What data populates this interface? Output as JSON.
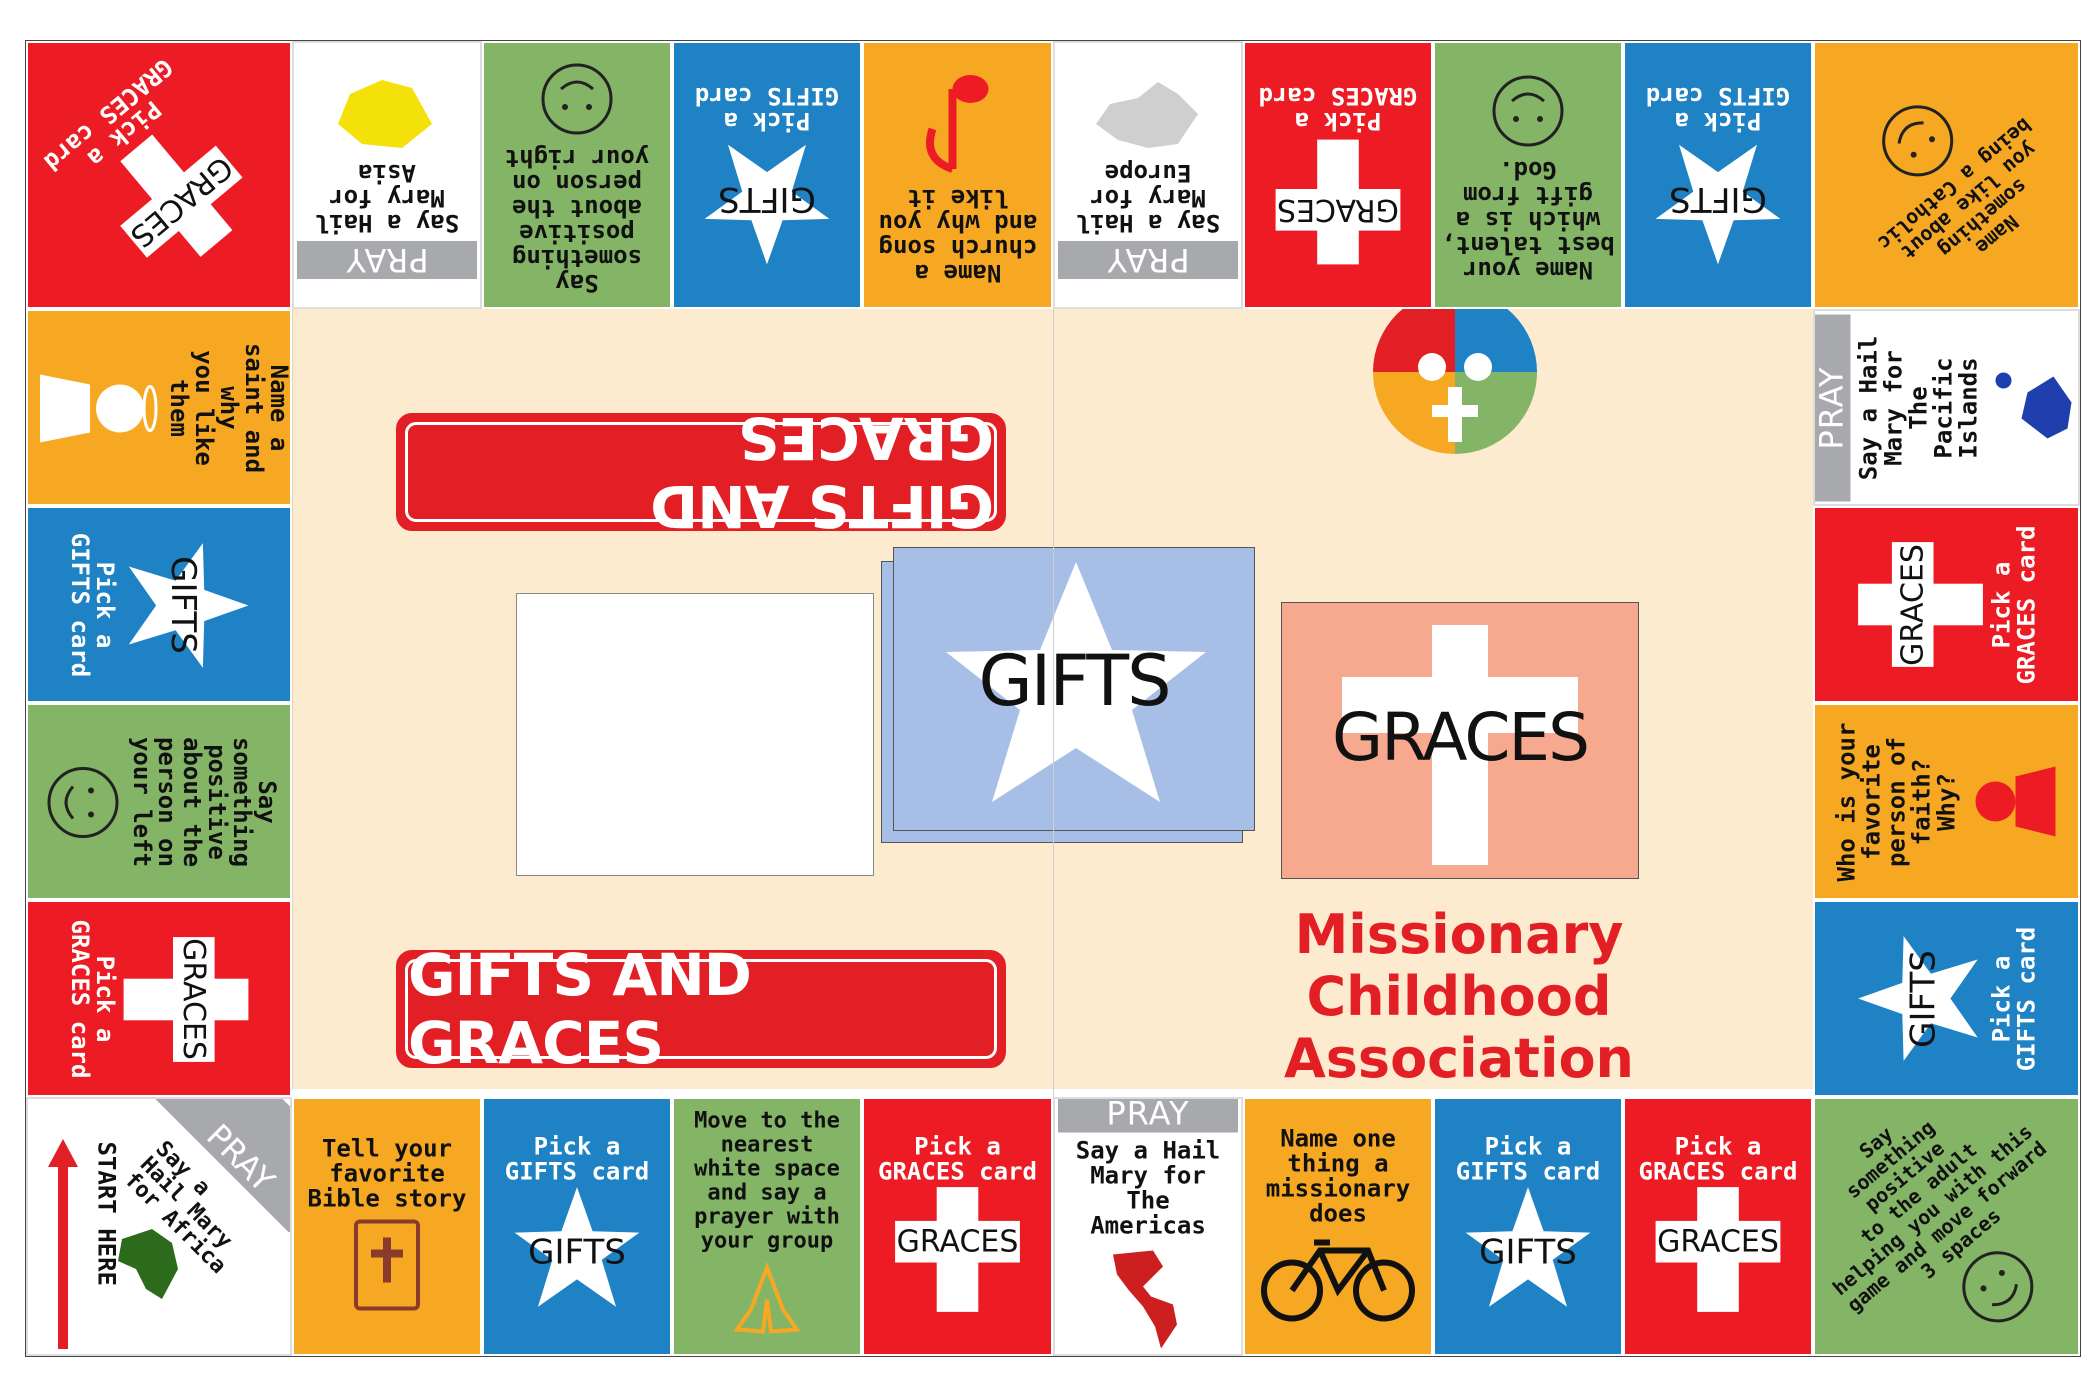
{
  "colors": {
    "red": "#ed1c24",
    "yellow": "#f7a823",
    "green": "#84b466",
    "blue": "#1e82c5",
    "gray": "#a8a9ad",
    "cream": "#fdebcf",
    "gifts_card": "#a7bfe6",
    "graces_card": "#f7a98f"
  },
  "board": {
    "banner_top": "GIFTS AND GRACES",
    "banner_bottom": "GIFTS AND GRACES",
    "gifts_card": "GIFTS",
    "graces_card": "GRACES",
    "org_name": "Missionary\nChildhood\nAssociation"
  },
  "squares": {
    "b0": {
      "text": "START HERE",
      "pray": "PRAY",
      "sub": "Say a\nHail Mary\nfor Africa"
    },
    "b1": {
      "text": "Tell your\nfavorite\nBible story"
    },
    "b2": {
      "text": "Pick a\nGIFTS card",
      "sym": "GIFTS"
    },
    "b3": {
      "text": "Move to the\nnearest\nwhite space\nand say a\nprayer with\nyour group"
    },
    "b4": {
      "text": "Pick a\nGRACES card",
      "sym": "GRACES"
    },
    "b5": {
      "pray": "PRAY",
      "text": "Say a Hail\nMary for\nThe\nAmericas"
    },
    "b6": {
      "text": "Name one\nthing a\nmissionary\ndoes"
    },
    "b7": {
      "text": "Pick a\nGIFTS card",
      "sym": "GIFTS"
    },
    "b8": {
      "text": "Pick a\nGRACES card",
      "sym": "GRACES"
    },
    "b9": {
      "text": "Say\nsomething\npositive\nto the adult\nhelping you with this\ngame and move forward\n3 spaces"
    },
    "r1": {
      "text": "Pick a\nGIFTS card",
      "sym": "GIFTS"
    },
    "r2": {
      "text": "Who is your\nfavorite\nperson of\nfaith?\nWhy?"
    },
    "r3": {
      "text": "Pick a\nGRACES card",
      "sym": "GRACES"
    },
    "r4": {
      "pray": "PRAY",
      "text": "Say a Hail\nMary for\nThe\nPacific Islands"
    },
    "t9": {
      "text": "Name\nsomething\nyou like about\nbeing a Catholic"
    },
    "t8": {
      "text": "Pick a\nGIFTS card",
      "sym": "GIFTS"
    },
    "t7": {
      "text": "Name your\nbest talent,\nwhich is a\ngift from\nGod."
    },
    "t6": {
      "text": "Pick a\nGRACES card",
      "sym": "GRACES"
    },
    "t5": {
      "pray": "PRAY",
      "text": "Say a Hail\nMary for\nEurope"
    },
    "t4": {
      "text": "Name a\nchurch song\nand why you\nlike it"
    },
    "t3": {
      "text": "Pick a\nGIFTS card",
      "sym": "GIFTS"
    },
    "t2": {
      "text": "Say\nsomething\npositive\nabout the\nperson on\nyour right"
    },
    "t1": {
      "pray": "PRAY",
      "text": "Say a Hail\nMary for\nAsia"
    },
    "t0": {
      "text": "Pick a\nGRACES card",
      "sym": "GRACES"
    },
    "l1": {
      "text": "Name a\nsaint and why\nyou like\nthem"
    },
    "l2": {
      "text": "Pick a\nGIFTS card",
      "sym": "GIFTS"
    },
    "l3": {
      "text": "Say\nsomething\npositive\nabout the\nperson on\nyour left"
    },
    "l4": {
      "text": "Pick a\nGRACES card",
      "sym": "GRACES"
    }
  }
}
